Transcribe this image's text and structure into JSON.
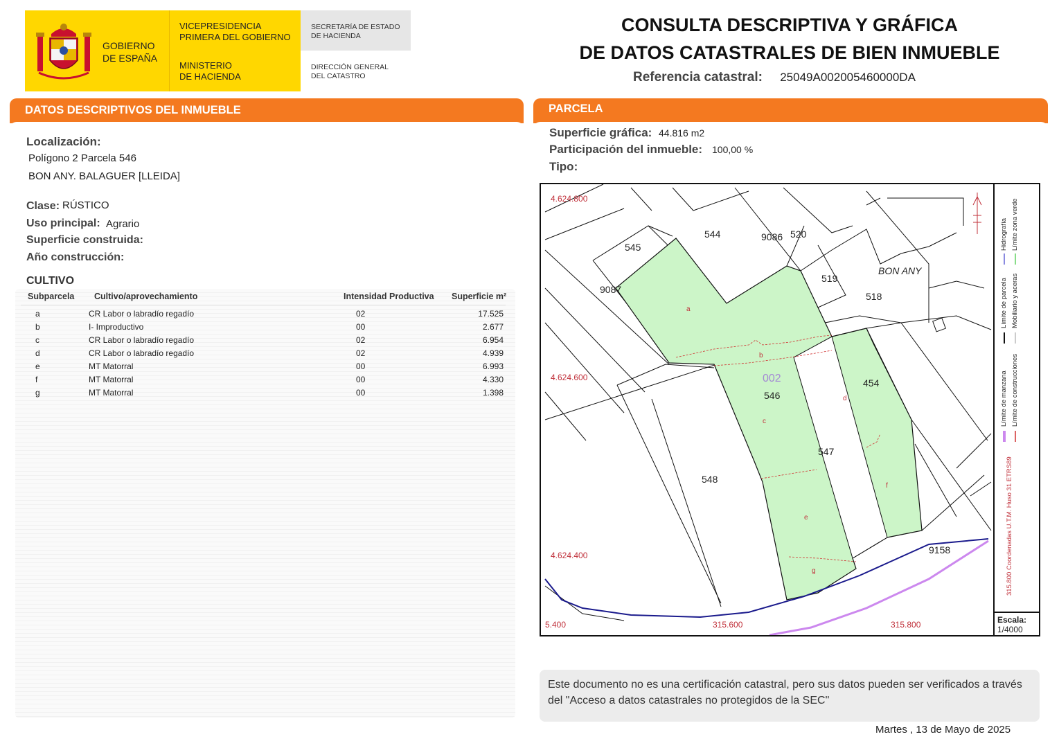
{
  "header": {
    "gov_name": [
      "GOBIERNO",
      "DE ESPAÑA"
    ],
    "vicepresidencia": [
      "VICEPRESIDENCIA",
      "PRIMERA DEL GOBIERNO"
    ],
    "ministerio": [
      "MINISTERIO",
      "DE HACIENDA"
    ],
    "secretaria": [
      "SECRETARÍA DE ESTADO",
      "DE HACIENDA"
    ],
    "direccion": [
      "DIRECCIÓN GENERAL",
      "DEL CATASTRO"
    ],
    "title_line1": "CONSULTA DESCRIPTIVA Y GRÁFICA",
    "title_line2": "DE DATOS CATASTRALES DE BIEN INMUEBLE",
    "ref_label": "Referencia catastral:",
    "ref_value": "25049A002005460000DA"
  },
  "descriptivos": {
    "section_title": "DATOS DESCRIPTIVOS DEL INMUEBLE",
    "localizacion_label": "Localización:",
    "localizacion_line1": "Polígono 2 Parcela 546",
    "localizacion_line2": "BON ANY. BALAGUER [LLEIDA]",
    "clase_label": "Clase:",
    "clase_value": "RÚSTICO",
    "uso_label": "Uso principal:",
    "uso_value": "Agrario",
    "superficie_label": "Superficie construida:",
    "anio_label": "Año construcción:"
  },
  "cultivo": {
    "title": "CULTIVO",
    "headers": [
      "Subparcela",
      "Cultivo/aprovechamiento",
      "Intensidad Productiva",
      "Superficie m²"
    ],
    "rows": [
      [
        "a",
        "CR Labor o labradío regadío",
        "02",
        "17.525"
      ],
      [
        "b",
        "I- Improductivo",
        "00",
        "2.677"
      ],
      [
        "c",
        "CR Labor o labradío regadío",
        "02",
        "6.954"
      ],
      [
        "d",
        "CR Labor o labradío regadío",
        "02",
        "4.939"
      ],
      [
        "e",
        "MT Matorral",
        "00",
        "6.993"
      ],
      [
        "f",
        "MT Matorral",
        "00",
        "4.330"
      ],
      [
        "g",
        "MT Matorral",
        "00",
        "1.398"
      ]
    ]
  },
  "parcela": {
    "section_title": "PARCELA",
    "superficie_label": "Superficie gráfica:",
    "superficie_value": "44.816 m2",
    "participacion_label": "Participación del inmueble:",
    "participacion_value": "100,00 %",
    "tipo_label": "Tipo:"
  },
  "map": {
    "coords": {
      "y1": "4.624.800",
      "y2": "4.624.600",
      "y3": "4.624.400",
      "x1": "5.400",
      "x2": "315.600",
      "x3": "315.800"
    },
    "parcel_labels": [
      "544",
      "9086",
      "520",
      "545",
      "519",
      "518",
      "9087",
      "454",
      "002",
      "546",
      "547",
      "548",
      "9158"
    ],
    "place_name": "BON ANY",
    "subparcel_letters": [
      "a",
      "b",
      "c",
      "d",
      "e",
      "f",
      "g"
    ],
    "legend": {
      "hidrografia": "Hidrografía",
      "zona_verde": "Límite zona verde",
      "limite_parcela": "Límite de parcela",
      "mobiliario": "Mobiliario y aceras",
      "limite_manzana": "Límite de manzana",
      "limite_construcciones": "Límite de construcciones",
      "coord_note": "315.800 Coordenadas U.T.M. Huso 31 ETRS89"
    },
    "scale_label": "Escala:",
    "scale_value": "1/4000",
    "colors": {
      "parcel_fill": "#ccf5c8",
      "parcel_line": "#111111",
      "subparcel_line": "#d03030",
      "hydro": "#1a1a8c",
      "green_limit": "#cc88ee",
      "coord_text": "#c0303a"
    }
  },
  "notice": "Este documento no es una certificación catastral, pero sus datos pueden ser verificados a través del \"Acceso a datos catastrales no protegidos de la SEC\"",
  "date": "Martes , 13 de Mayo de 2025",
  "colors": {
    "orange": "#f47920",
    "yellow": "#ffd700",
    "grey": "#e6e6e6"
  }
}
